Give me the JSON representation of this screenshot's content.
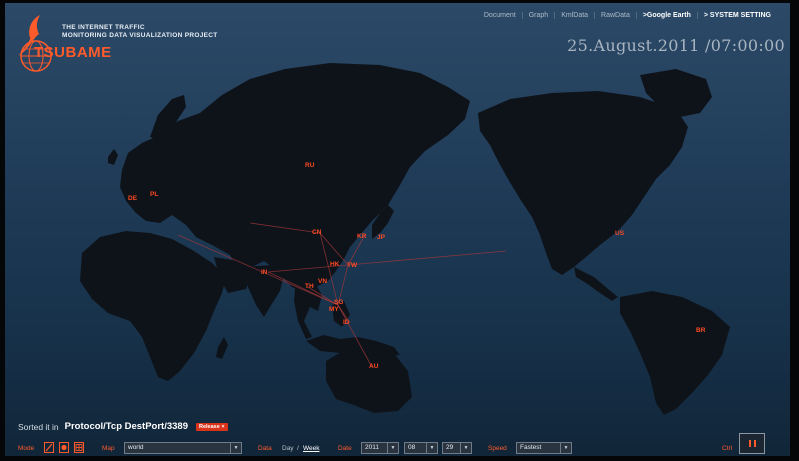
{
  "brand": {
    "project_line_1": "THE INTERNET TRAFFIC",
    "project_line_2": "MONITORING DATA VISUALIZATION PROJECT",
    "name": "TSUBAME",
    "accent_color": "#ff5a2a"
  },
  "nav": {
    "items": [
      {
        "label": "Document"
      },
      {
        "label": "Graph"
      },
      {
        "label": "KmlData"
      },
      {
        "label": "RawData"
      },
      {
        "label": ">Google Earth"
      },
      {
        "label": "> SYSTEM SETTING"
      }
    ]
  },
  "datetime": "25.August.2011 /07:00:00",
  "countries": [
    {
      "code": "DE"
    },
    {
      "code": "PL"
    },
    {
      "code": "RU"
    },
    {
      "code": "CN"
    },
    {
      "code": "KR"
    },
    {
      "code": "JP"
    },
    {
      "code": "IN"
    },
    {
      "code": "HK"
    },
    {
      "code": "TW"
    },
    {
      "code": "TH"
    },
    {
      "code": "VN"
    },
    {
      "code": "SG"
    },
    {
      "code": "MY"
    },
    {
      "code": "ID"
    },
    {
      "code": "AU"
    },
    {
      "code": "US"
    },
    {
      "code": "BR"
    }
  ],
  "sort": {
    "prefix": "Sorted it in",
    "value": "Protocol/Tcp DestPort/3389",
    "release_label": "Release ×"
  },
  "controls": {
    "mode_label": "Mode",
    "map_label": "Map",
    "map_value": "world",
    "data_label": "Data",
    "data_day": "Day",
    "data_separator": "/",
    "data_week": "Week",
    "date_label": "Date",
    "year": "2011",
    "month": "08",
    "day": "29",
    "speed_label": "Speed",
    "speed_value": "Fastest",
    "ctrl_label": "Ctrl"
  }
}
